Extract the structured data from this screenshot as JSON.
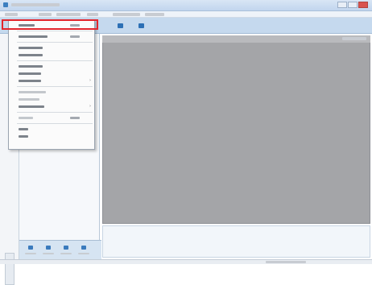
{
  "colors": {
    "accent": "#2d70b5",
    "highlight_box": "#e3262d",
    "document_bg": "#a4a5a8"
  },
  "icons": {
    "window_buttons": [
      "minimize-icon",
      "maximize-icon",
      "close-icon"
    ],
    "toolbar": [
      "toolbar-tool-icon",
      "toolbar-tool-icon"
    ],
    "dropdown_submenu": "chevron-right-icon"
  },
  "dropdown": {
    "items": [
      {
        "kind": "item",
        "has_shortcut": true,
        "highlighted": true
      },
      {
        "kind": "separator"
      },
      {
        "kind": "item",
        "has_shortcut": true
      },
      {
        "kind": "separator"
      },
      {
        "kind": "item"
      },
      {
        "kind": "item"
      },
      {
        "kind": "separator"
      },
      {
        "kind": "item"
      },
      {
        "kind": "item"
      },
      {
        "kind": "item",
        "has_submenu": true
      },
      {
        "kind": "separator"
      },
      {
        "kind": "item",
        "disabled": true
      },
      {
        "kind": "item",
        "disabled": true
      },
      {
        "kind": "item",
        "has_submenu": true
      },
      {
        "kind": "separator"
      },
      {
        "kind": "item",
        "disabled": true,
        "has_shortcut": true
      },
      {
        "kind": "separator"
      },
      {
        "kind": "item"
      },
      {
        "kind": "item"
      }
    ]
  },
  "dropdown_glyphs": {
    "submenu_arrow": "›"
  }
}
